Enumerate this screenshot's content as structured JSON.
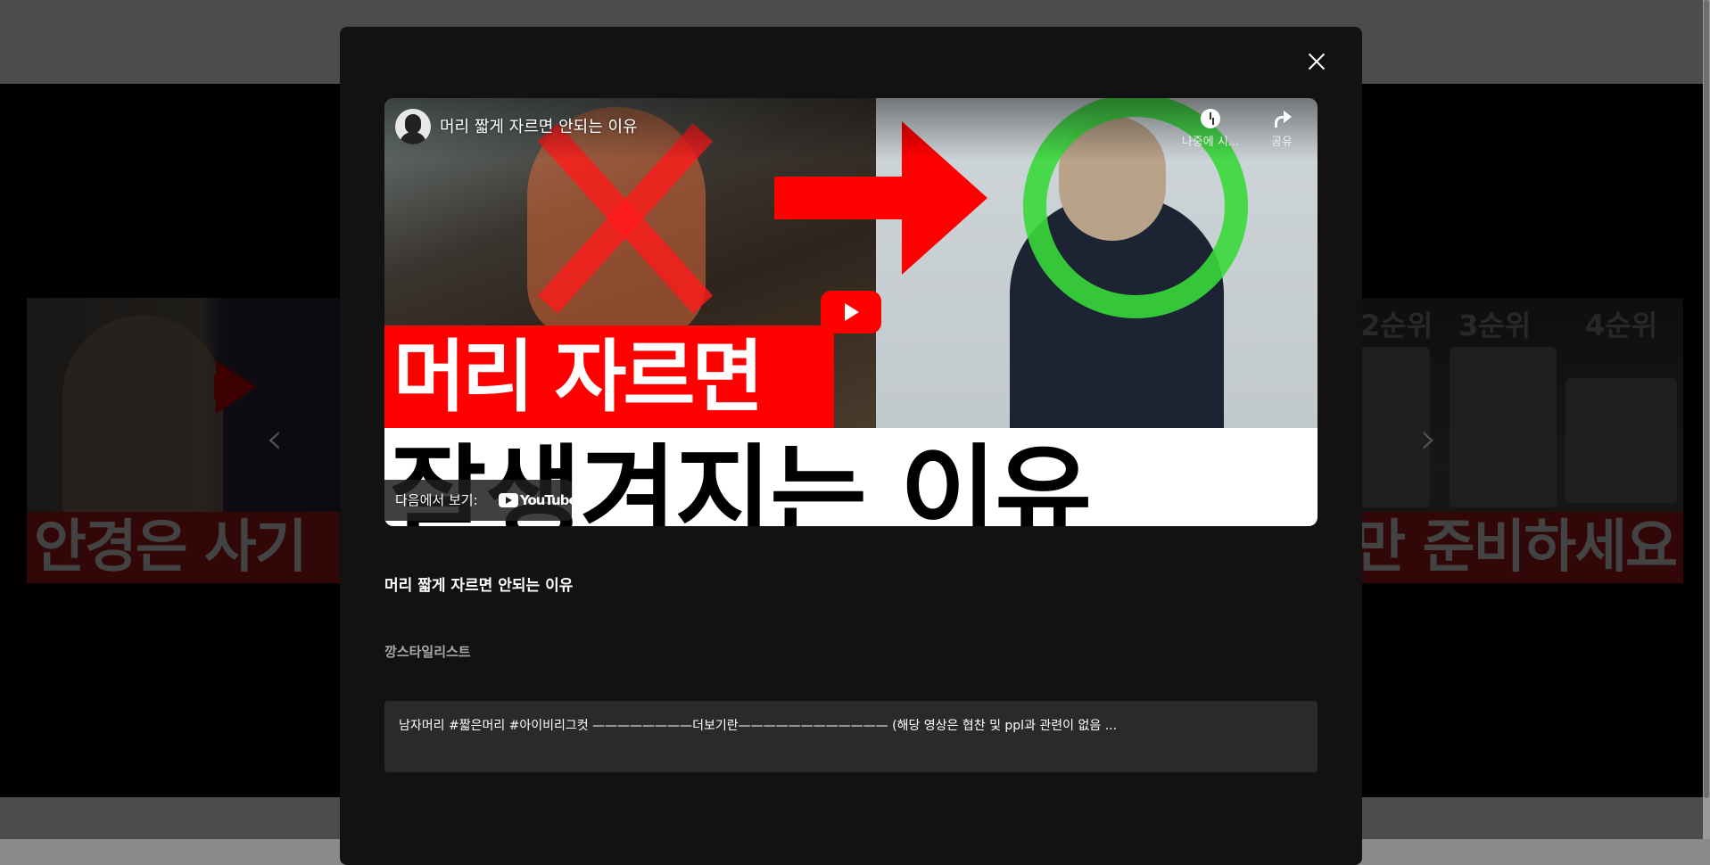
{
  "background": {
    "left_card_caption": "안경은 사기",
    "right_card_caption": "만 준비하세요",
    "right_card_ranks": [
      "2순위",
      "3순위",
      "4순위"
    ],
    "prev_label": "‹",
    "next_label": "›"
  },
  "modal": {
    "close_icon": "close-icon",
    "player": {
      "title": "머리 짧게 자르면 안되는 이유",
      "actions": [
        {
          "label": "나중에 시...",
          "icon": "clock-icon"
        },
        {
          "label": "공유",
          "icon": "share-icon"
        }
      ],
      "watch_on_label": "다음에서 보기:",
      "watch_on_brand": "YouTube",
      "thumbnail_caption_red": "머리 자르면",
      "thumbnail_caption_white": "잘생겨지는 이유",
      "play_icon": "play-icon"
    },
    "video_title": "머리 짧게 자르면 안되는 이유",
    "channel_name": "깡스타일리스트",
    "description": "남자머리 #짧은머리 #아이비리그컷 ————————더보기란———————————— (해당 영상은 협찬 및 ppl과 관련이 없음 ..."
  },
  "colors": {
    "modal_bg": "#121212",
    "accent_red": "#ff0000",
    "description_bg": "#2a2a2a"
  }
}
